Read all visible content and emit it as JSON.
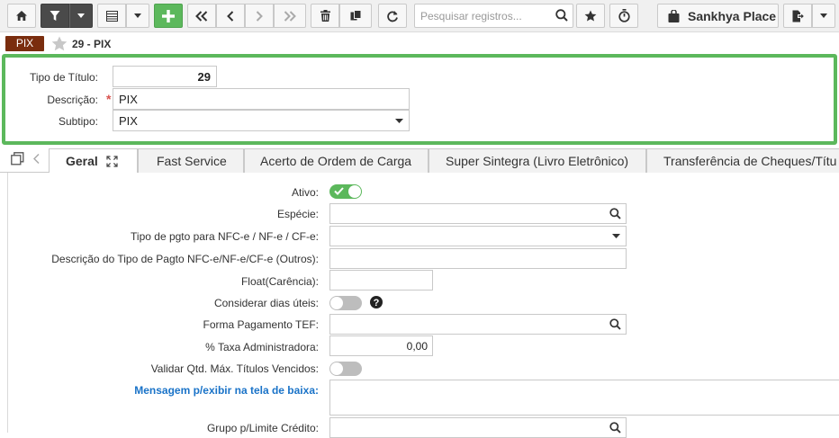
{
  "toolbar": {
    "search_placeholder": "Pesquisar registros...",
    "place_label": "Sankhya Place"
  },
  "record": {
    "tag": "PIX",
    "title": "29 - PIX"
  },
  "header_form": {
    "tipo_titulo_label": "Tipo de Título:",
    "tipo_titulo_value": "29",
    "descricao_label": "Descrição:",
    "descricao_value": "PIX",
    "subtipo_label": "Subtipo:",
    "subtipo_value": "PIX"
  },
  "tabs": [
    {
      "label": "Geral"
    },
    {
      "label": "Fast Service"
    },
    {
      "label": "Acerto de Ordem de Carga"
    },
    {
      "label": "Super Sintegra (Livro Eletrônico)"
    },
    {
      "label": "Transferência de Cheques/Títu"
    }
  ],
  "fields": {
    "ativo_label": "Ativo:",
    "especie_label": "Espécie:",
    "tipo_pgto_label": "Tipo de pgto para NFC-e / NF-e / CF-e:",
    "descricao_pagto_label": "Descrição do Tipo de Pagto NFC-e/NF-e/CF-e (Outros):",
    "float_label": "Float(Carência):",
    "considerar_dias_label": "Considerar dias úteis:",
    "forma_pagamento_label": "Forma Pagamento TEF:",
    "taxa_label": "% Taxa Administradora:",
    "taxa_value": "0,00",
    "validar_label": "Validar Qtd. Máx. Títulos Vencidos:",
    "mensagem_label": "Mensagem p/exibir na tela de baixa:",
    "grupo_label": "Grupo p/Limite Crédito:"
  },
  "toggles": {
    "ativo": true,
    "considerar_dias_uteis": false,
    "validar_qtd": false
  },
  "colors": {
    "accent_green": "#5cb85c",
    "tag_brown": "#7a2d0e",
    "link_blue": "#1a73c8",
    "required_red": "#d9534f"
  }
}
